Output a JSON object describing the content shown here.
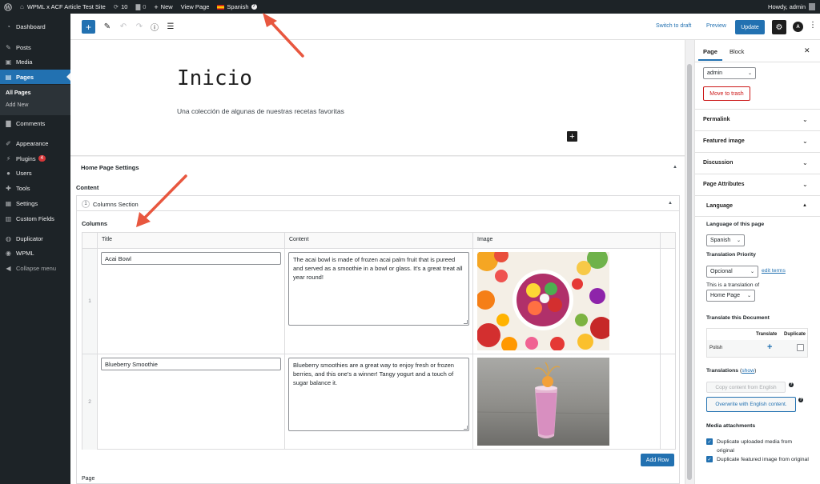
{
  "admin_bar": {
    "site_name": "WPML x ACF Article Test Site",
    "updates_count": "10",
    "comments_count": "0",
    "new_label": "New",
    "view_page_label": "View Page",
    "language_label": "Spanish",
    "greeting": "Howdy, admin"
  },
  "sidebar": {
    "items": [
      {
        "label": "Dashboard"
      },
      {
        "label": "Posts"
      },
      {
        "label": "Media"
      },
      {
        "label": "Pages"
      },
      {
        "label": "Comments"
      },
      {
        "label": "Appearance"
      },
      {
        "label": "Plugins",
        "badge": "4"
      },
      {
        "label": "Users"
      },
      {
        "label": "Tools"
      },
      {
        "label": "Settings"
      },
      {
        "label": "Custom Fields"
      },
      {
        "label": "Duplicator"
      },
      {
        "label": "WPML"
      },
      {
        "label": "Collapse menu"
      }
    ],
    "submenu": [
      "All Pages",
      "Add New"
    ]
  },
  "toolbar": {
    "switch_to_draft": "Switch to draft",
    "preview": "Preview",
    "update": "Update"
  },
  "page": {
    "title": "Inicio",
    "excerpt": "Una colección de algunas de nuestras recetas favoritas"
  },
  "metabox": {
    "title": "Home Page Settings",
    "content_label": "Content",
    "layout_order": "1",
    "layout_name": "Columns Section",
    "columns_label": "Columns",
    "headers": [
      "Title",
      "Content",
      "Image"
    ],
    "rows": [
      {
        "num": "1",
        "title": "Acai Bowl",
        "content": "The acai bowl is made of frozen acai palm fruit that is pureed and served as a smoothie in a bowl or glass. It's a great treat all year round!"
      },
      {
        "num": "2",
        "title": "Blueberry Smoothie",
        "content": "Blueberry smoothies are a great way to enjoy fresh or frozen berries, and this one's a winner! Tangy yogurt and a touch of sugar balance it."
      }
    ],
    "add_row": "Add Row",
    "footer_label": "Page"
  },
  "right_panel": {
    "tab_page": "Page",
    "tab_block": "Block",
    "author_value": "admin",
    "move_to_trash": "Move to trash",
    "sections": [
      "Permalink",
      "Featured image",
      "Discussion",
      "Page Attributes"
    ],
    "language": {
      "title": "Language",
      "lang_of_page": "Language of this page",
      "lang_value": "Spanish",
      "translation_priority": "Translation Priority",
      "priority_value": "Opcional",
      "edit_terms": "edit terms",
      "translation_of": "This is a translation of",
      "translation_of_value": "Home Page",
      "translate_doc": "Translate this Document",
      "col_translate": "Translate",
      "col_duplicate": "Duplicate",
      "row_lang": "Polish",
      "translations_label": "Translations",
      "show_link": "show",
      "copy_content": "Copy content from English",
      "overwrite": "Overwrite with English content.",
      "media_attachments": "Media attachments",
      "dup_media": "Duplicate uploaded media from original",
      "dup_featured": "Duplicate featured image from original"
    }
  },
  "colors": {
    "wp_dark": "#1d2327",
    "wp_blue": "#2271b1",
    "annotation_arrow": "#e8573f",
    "trash_red": "#cc1818"
  }
}
